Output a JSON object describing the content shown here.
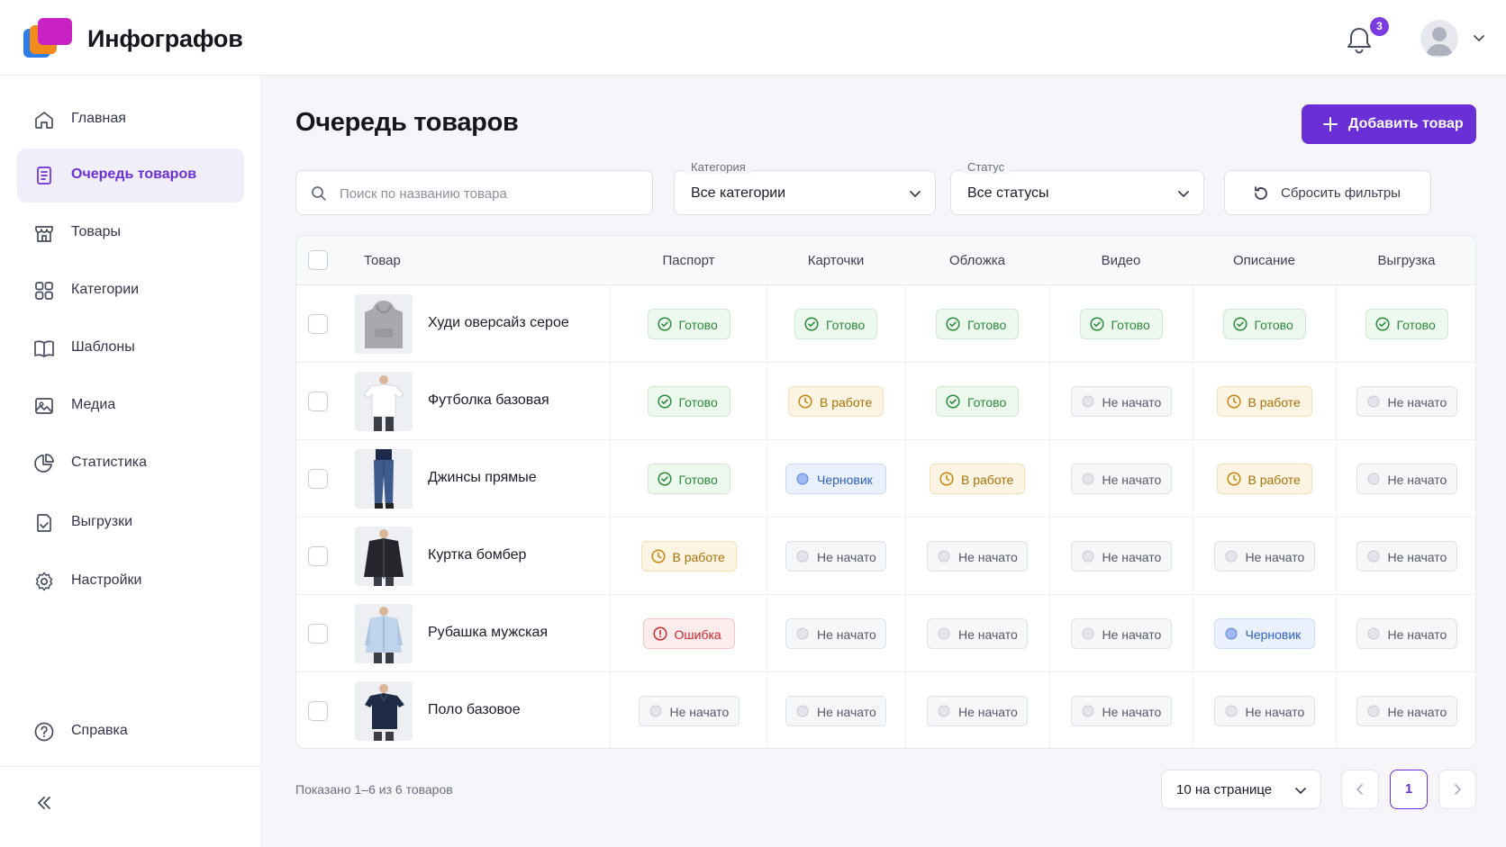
{
  "app": {
    "name": "Инфографов",
    "notifications_count": "3",
    "colors": {
      "accent": "#6a2fd6",
      "done": "#2a8a3a",
      "in_progress": "#a8700a",
      "draft": "#2c5fbf",
      "error": "#c8282c"
    }
  },
  "sidebar": {
    "items": [
      {
        "label": "Главная",
        "icon": "home-icon",
        "active": false
      },
      {
        "label": "Очередь товаров",
        "icon": "document-icon",
        "active": true
      },
      {
        "label": "Товары",
        "icon": "shop-icon",
        "active": false
      },
      {
        "label": "Категории",
        "icon": "grid-icon",
        "active": false
      },
      {
        "label": "Шаблоны",
        "icon": "book-icon",
        "active": false
      },
      {
        "label": "Медиа",
        "icon": "image-icon",
        "active": false
      },
      {
        "label": "Статистика",
        "icon": "pie-chart-icon",
        "active": false
      },
      {
        "label": "Выгрузки",
        "icon": "export-icon",
        "active": false
      },
      {
        "label": "Настройки",
        "icon": "gear-icon",
        "active": false
      }
    ],
    "help_label": "Справка"
  },
  "main": {
    "title": "Очередь товаров",
    "add_button": "Добавить товар",
    "search_placeholder": "Поиск по названию товара",
    "category_filter": {
      "label": "Категория",
      "value": "Все категории"
    },
    "status_filter": {
      "label": "Статус",
      "value": "Все статусы"
    },
    "reset_button": "Сбросить фильтры"
  },
  "table": {
    "columns": [
      "Товар",
      "Паспорт",
      "Карточки",
      "Обложка",
      "Видео",
      "Описание",
      "Выгрузка"
    ],
    "status_labels": {
      "done": "Готово",
      "work": "В работе",
      "draft": "Черновик",
      "none": "Не начато",
      "err": "Ошибка"
    },
    "rows": [
      {
        "name": "Худи оверсайз серое",
        "thumb": "hoodie",
        "statuses": [
          "done",
          "done",
          "done",
          "done",
          "done",
          "done"
        ]
      },
      {
        "name": "Футболка базовая",
        "thumb": "tshirt",
        "statuses": [
          "done",
          "work",
          "done",
          "none",
          "work",
          "none"
        ]
      },
      {
        "name": "Джинсы прямые",
        "thumb": "jeans",
        "statuses": [
          "done",
          "draft",
          "work",
          "none",
          "work",
          "none"
        ]
      },
      {
        "name": "Куртка бомбер",
        "thumb": "jacket",
        "statuses": [
          "work",
          "none",
          "none",
          "none",
          "none",
          "none"
        ]
      },
      {
        "name": "Рубашка мужская",
        "thumb": "shirt",
        "statuses": [
          "err",
          "none",
          "none",
          "none",
          "draft",
          "none"
        ]
      },
      {
        "name": "Поло базовое",
        "thumb": "polo",
        "statuses": [
          "none",
          "none",
          "none",
          "none",
          "none",
          "none"
        ]
      }
    ]
  },
  "footer": {
    "shown_text": "Показано 1–6 из 6 товаров",
    "per_page": "10 на странице",
    "current_page": "1"
  }
}
